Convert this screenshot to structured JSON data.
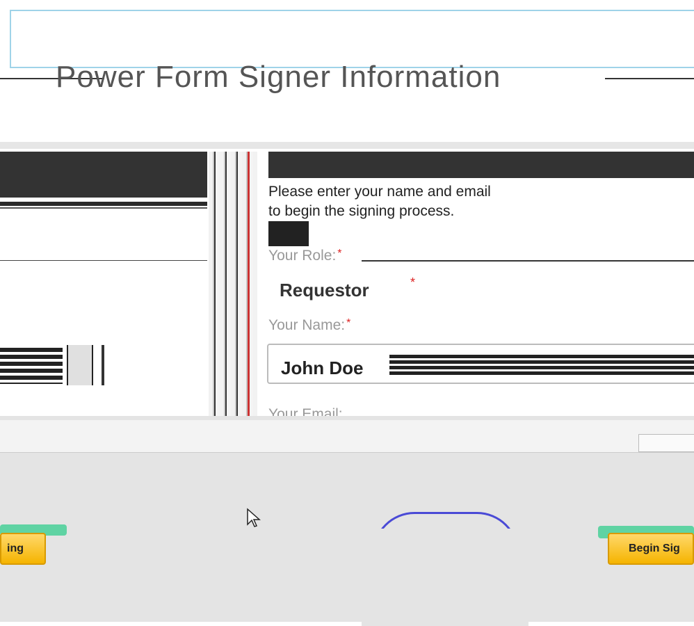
{
  "page": {
    "title": "Power Form Signer Information"
  },
  "form": {
    "intro_line1": "Please enter your name and email",
    "intro_line2": "to begin the signing process.",
    "role_label": "Your Role:",
    "role_value": "Requestor",
    "name_label": "Your Name:",
    "name_value": "John Doe",
    "email_label": "Your Email:",
    "required_mark": "*"
  },
  "buttons": {
    "begin_left": "ing",
    "begin_right": "Begin Sig"
  },
  "colors": {
    "accent_yellow": "#f5b400",
    "required_red": "#dd2222",
    "banner_border": "#9fd3e8"
  }
}
